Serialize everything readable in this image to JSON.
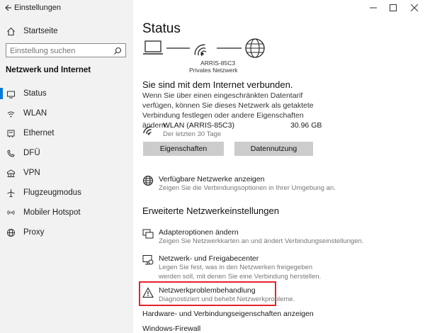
{
  "window": {
    "title": "Einstellungen"
  },
  "sidebar": {
    "home_label": "Startseite",
    "search_placeholder": "Einstellung suchen",
    "section_title": "Netzwerk und Internet",
    "items": [
      {
        "label": "Status",
        "icon": "home-status-icon"
      },
      {
        "label": "WLAN",
        "icon": "wifi-icon"
      },
      {
        "label": "Ethernet",
        "icon": "ethernet-icon"
      },
      {
        "label": "DFÜ",
        "icon": "dialup-icon"
      },
      {
        "label": "VPN",
        "icon": "vpn-icon"
      },
      {
        "label": "Flugzeugmodus",
        "icon": "airplane-icon"
      },
      {
        "label": "Mobiler Hotspot",
        "icon": "hotspot-icon"
      },
      {
        "label": "Proxy",
        "icon": "globe-icon"
      }
    ],
    "active_index": 0,
    "accent": "#0078d7"
  },
  "main": {
    "title": "Status",
    "diagram": {
      "network_name": "ARRIS-85C3",
      "network_type": "Privates Netzwerk"
    },
    "connected_heading": "Sie sind mit dem Internet verbunden.",
    "connected_desc": "Wenn Sie über einen eingeschränkten Datentarif verfügen, können Sie dieses Netzwerk als getaktete Verbindung festlegen oder andere Eigenschaften ändern.",
    "connection": {
      "name": "WLAN (ARRIS-85C3)",
      "period": "Der letzten 30 Tage",
      "usage": "30.96 GB"
    },
    "buttons": {
      "properties": "Eigenschaften",
      "data_usage": "Datennutzung"
    },
    "available": {
      "title": "Verfügbare Netzwerke anzeigen",
      "desc": "Zeigen Sie die Verbindungsoptionen in Ihrer Umgebung an."
    },
    "advanced_heading": "Erweiterte Netzwerkeinstellungen",
    "adapter": {
      "title": "Adapteroptionen ändern",
      "desc": "Zeigen Sie Netzwerkkarten an und ändert Verbindungseinstellungen."
    },
    "sharing": {
      "title": "Netzwerk- und Freigabecenter",
      "desc": "Legen Sie fest, was in den Netzwerken freigegeben werden soll, mit denen Sie eine Verbindung herstellen."
    },
    "troubleshoot": {
      "title": "Netzwerkproblembehandlung",
      "desc": "Diagnostiziert und behebt Netzwerkprobleme.",
      "highlight_color": "#e8212b"
    },
    "hw_link": "Hardware- und Verbindungseigenschaften anzeigen",
    "firewall_link": "Windows-Firewall"
  }
}
